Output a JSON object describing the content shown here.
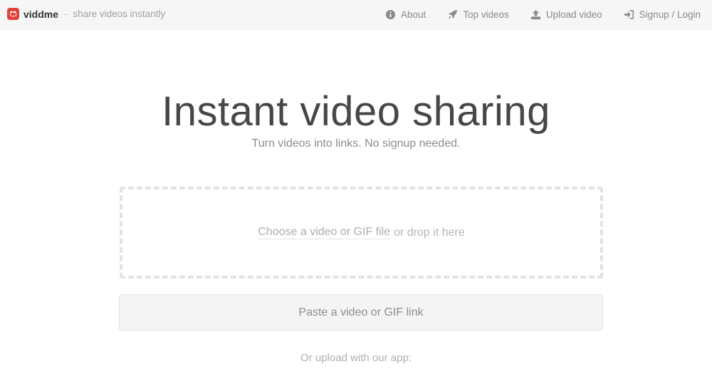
{
  "header": {
    "brand_name": "viddme",
    "separator": "-",
    "tagline": "share videos instantly",
    "nav": [
      {
        "icon": "info-circle-icon",
        "label": "About"
      },
      {
        "icon": "rocket-icon",
        "label": "Top videos"
      },
      {
        "icon": "upload-icon",
        "label": "Upload video"
      },
      {
        "icon": "sign-in-icon",
        "label": "Signup / Login"
      }
    ]
  },
  "hero": {
    "title": "Instant video sharing",
    "subtitle": "Turn videos into links. No signup needed."
  },
  "dropzone": {
    "choose_link": "Choose a video or GIF file",
    "rest": "or drop it here"
  },
  "paste_box": {
    "label": "Paste a video or GIF link"
  },
  "app_upload": {
    "label": "Or upload with our app:"
  },
  "colors": {
    "brand_red": "#e0403a",
    "topbar_bg": "#f6f6f7",
    "title": "#474747"
  }
}
